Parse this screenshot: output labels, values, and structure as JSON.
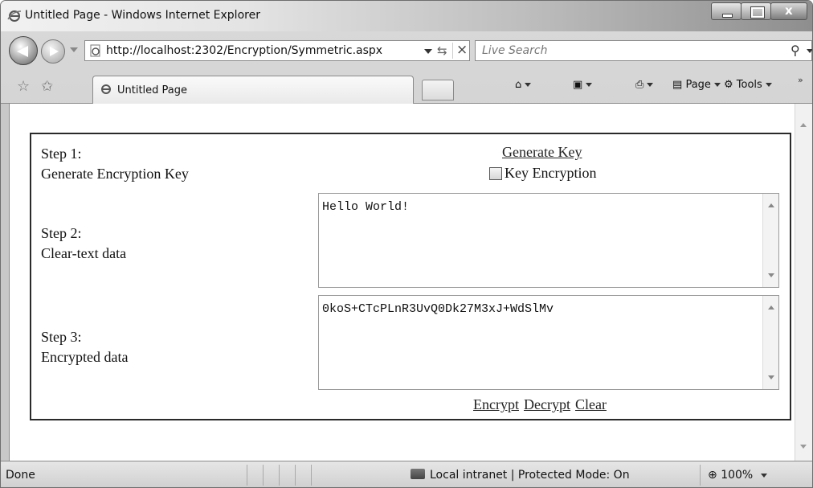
{
  "window": {
    "title": "Untitled Page - Windows Internet Explorer"
  },
  "address_bar": {
    "url": "http://localhost:2302/Encryption/Symmetric.aspx"
  },
  "search": {
    "placeholder": "Live Search"
  },
  "tab": {
    "label": "Untitled Page"
  },
  "command_bar": {
    "page_label": "Page",
    "tools_label": "Tools"
  },
  "form": {
    "step1": {
      "title": "Step 1:",
      "description": "Generate Encryption Key"
    },
    "step2": {
      "title": "Step 2:",
      "description": "Clear-text data"
    },
    "step3": {
      "title": "Step 3:",
      "description": "Encrypted data"
    },
    "generate_key_link": "Generate Key",
    "key_encryption_label": "Key Encryption",
    "key_encryption_checked": false,
    "clear_text_value": "Hello World!",
    "encrypted_value": "0koS+CTcPLnR3UvQ0Dk27M3xJ+WdSlMv",
    "encrypt_link": "Encrypt",
    "decrypt_link": "Decrypt",
    "clear_link": "Clear"
  },
  "status_bar": {
    "status": "Done",
    "zone": "Local intranet | Protected Mode: On",
    "zoom": "100%"
  },
  "icons": {
    "app": "ie-logo-icon",
    "back": "back-arrow-icon",
    "forward": "forward-arrow-icon",
    "refresh": "refresh-icon",
    "stop": "stop-icon",
    "search": "search-icon",
    "favorites": "favorites-star-icon",
    "add_favorites": "add-favorites-icon",
    "home": "home-icon",
    "feeds": "feeds-icon",
    "print": "print-icon",
    "page": "page-icon",
    "tools": "gear-icon",
    "zone": "local-intranet-icon",
    "zoom": "zoom-icon"
  }
}
